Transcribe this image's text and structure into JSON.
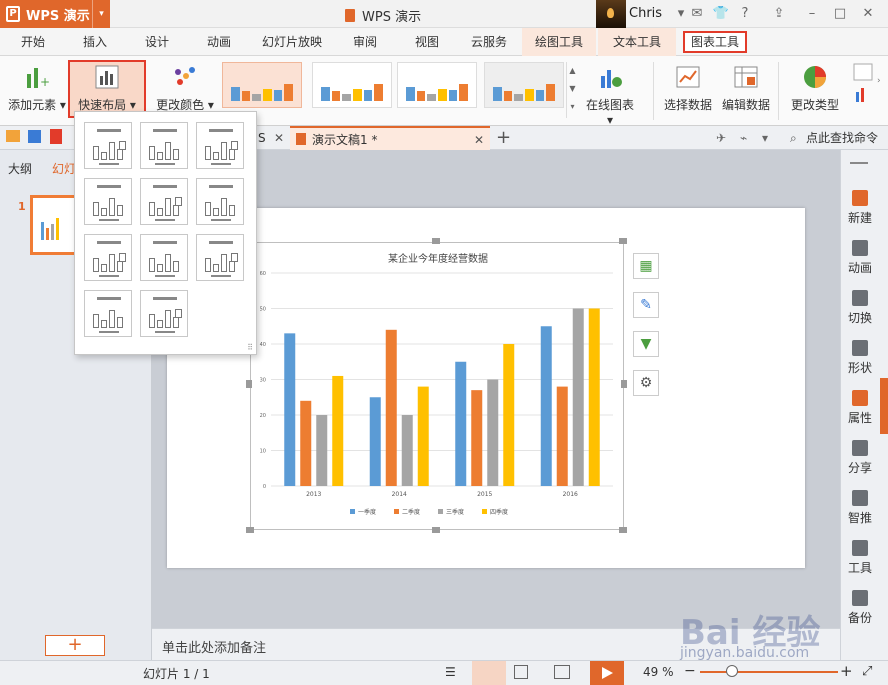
{
  "app": {
    "name": "WPS 演示",
    "title": "WPS 演示",
    "user": "Chris"
  },
  "ribbon_tabs": [
    "开始",
    "插入",
    "设计",
    "动画",
    "幻灯片放映",
    "审阅",
    "视图",
    "云服务",
    "绘图工具",
    "文本工具",
    "图表工具"
  ],
  "ribbon": {
    "add_element": "添加元素",
    "quick_layout": "快速布局",
    "change_color": "更改颜色",
    "online_chart": "在线图表",
    "select_data": "选择数据",
    "edit_data": "编辑数据",
    "change_type": "更改类型"
  },
  "doc_tabs": {
    "partial": "S",
    "doc": "演示文稿1 *",
    "find_cmd": "点此查找命令"
  },
  "left_panel": {
    "tab_outline": "大纲",
    "tab_slides": "幻灯",
    "slide_number": "1",
    "add_slide": "+"
  },
  "notes": "单击此处添加备注",
  "status": {
    "slide_count": "幻灯片 1 / 1",
    "zoom": "49 %"
  },
  "right_panel": [
    "新建",
    "动画",
    "切换",
    "形状",
    "属性",
    "分享",
    "智推",
    "工具",
    "备份"
  ],
  "watermark": {
    "text": "Bai 经验",
    "url": "jingyan.baidu.com"
  },
  "colors": {
    "accent": "#e0672b",
    "series": [
      "#5b9bd5",
      "#ed7d31",
      "#a5a5a5",
      "#ffc000"
    ]
  },
  "chart_data": {
    "type": "bar",
    "title": "某企业今年度经营数据",
    "categories": [
      "2013",
      "2014",
      "2015",
      "2016"
    ],
    "series": [
      {
        "name": "一季度",
        "values": [
          43,
          25,
          35,
          45
        ]
      },
      {
        "name": "二季度",
        "values": [
          24,
          44,
          27,
          28
        ]
      },
      {
        "name": "三季度",
        "values": [
          20,
          20,
          30,
          50
        ]
      },
      {
        "name": "四季度",
        "values": [
          31,
          28,
          40,
          50
        ]
      }
    ],
    "ylim": [
      0,
      60
    ],
    "yticks": [
      "0",
      "10",
      "20",
      "30",
      "40",
      "50",
      "60"
    ],
    "grid": true,
    "legend": "bottom"
  }
}
